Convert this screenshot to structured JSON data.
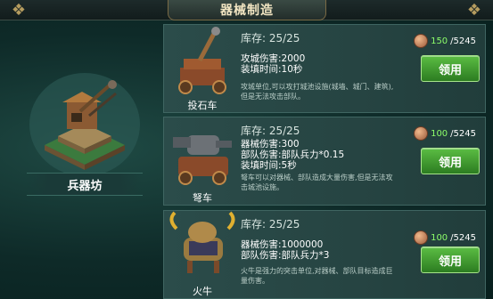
{
  "header": {
    "title": "器械制造"
  },
  "building": {
    "name": "兵器坊"
  },
  "cards": [
    {
      "name": "投石车",
      "stock": "库存: 25/25",
      "stats": [
        "攻城伤害:2000",
        "装填时间:10秒"
      ],
      "desc": "攻城单位,可以攻打城池设施(城墙、城门、建筑),但是无法攻击部队。",
      "cost_have": "150",
      "cost_total": "/5245",
      "button": "领用"
    },
    {
      "name": "弩车",
      "stock": "库存: 25/25",
      "stats": [
        "器械伤害:300",
        "部队伤害:部队兵力*0.15",
        "装填时间:5秒"
      ],
      "desc": "弩车可以对器械、部队造成大量伤害,但是无法攻击城池设施。",
      "cost_have": "100",
      "cost_total": "/5245",
      "button": "领用"
    },
    {
      "name": "火牛",
      "stock": "库存: 25/25",
      "stats": [
        "器械伤害:1000000",
        "部队伤害:部队兵力*3"
      ],
      "desc": "火牛是强力的突击单位,对器械、部队目标造成巨量伤害。",
      "cost_have": "100",
      "cost_total": "/5245",
      "button": "领用"
    }
  ]
}
